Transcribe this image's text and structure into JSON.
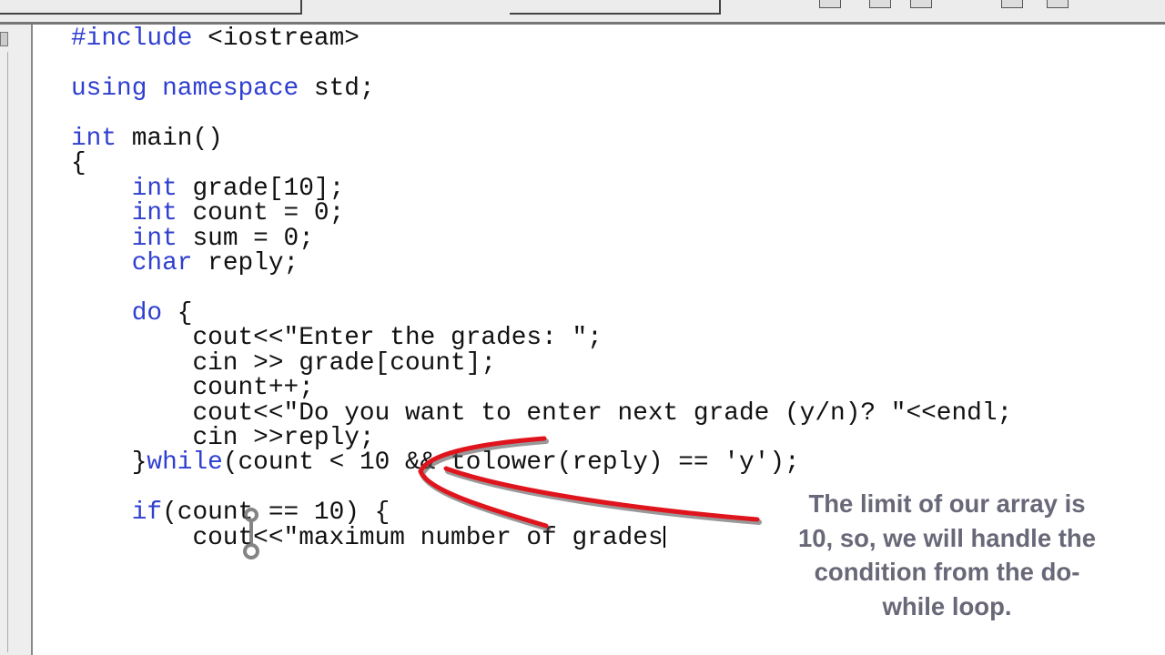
{
  "editor": {
    "lines": [
      [
        {
          "t": "#include",
          "k": 1
        },
        {
          "t": " <iostream>"
        }
      ],
      [],
      [
        {
          "t": "using",
          "k": 1
        },
        {
          "t": " "
        },
        {
          "t": "namespace",
          "k": 1
        },
        {
          "t": " std;"
        }
      ],
      [],
      [
        {
          "t": "int",
          "k": 1
        },
        {
          "t": " main()"
        }
      ],
      [
        {
          "t": "{"
        }
      ],
      [
        {
          "t": "    "
        },
        {
          "t": "int",
          "k": 1
        },
        {
          "t": " grade[10];"
        }
      ],
      [
        {
          "t": "    "
        },
        {
          "t": "int",
          "k": 1
        },
        {
          "t": " count = 0;"
        }
      ],
      [
        {
          "t": "    "
        },
        {
          "t": "int",
          "k": 1
        },
        {
          "t": " sum = 0;"
        }
      ],
      [
        {
          "t": "    "
        },
        {
          "t": "char",
          "k": 1
        },
        {
          "t": " reply;"
        }
      ],
      [],
      [
        {
          "t": "    "
        },
        {
          "t": "do",
          "k": 1
        },
        {
          "t": " {"
        }
      ],
      [
        {
          "t": "        cout<<\"Enter the grades: \";"
        }
      ],
      [
        {
          "t": "        cin >> grade[count];"
        }
      ],
      [
        {
          "t": "        count++;"
        }
      ],
      [
        {
          "t": "        cout<<\"Do you want to enter next grade (y/n)? \"<<endl;"
        }
      ],
      [
        {
          "t": "        cin >>reply;"
        }
      ],
      [
        {
          "t": "    }"
        },
        {
          "t": "while",
          "k": 1
        },
        {
          "t": "(count < 10 && tolower(reply) == 'y');"
        }
      ],
      [],
      [
        {
          "t": "    "
        },
        {
          "t": "if",
          "k": 1
        },
        {
          "t": "(count == 10) {"
        }
      ],
      [
        {
          "t": "        cout<<\"maximum number of grades"
        }
      ]
    ],
    "keyword_color": "#2f3fcf"
  },
  "annotation": {
    "lines": [
      "The limit of our array is",
      "10, so, we will handle the",
      "condition from the do-",
      "while loop."
    ],
    "text_color": "#686878",
    "arrow_color": "#e0141c"
  }
}
